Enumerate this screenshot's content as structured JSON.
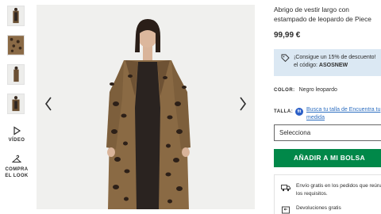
{
  "sidebar": {
    "video_label": "VÍDEO",
    "compra_label_1": "COMPRA",
    "compra_label_2": "EL LOOK"
  },
  "product": {
    "title_line1": "Abrigo de vestir largo con",
    "title_line2": "estampado de leopardo de Piece",
    "price": "99,99 €",
    "promo_line1": "¡Consigue un 15% de descuento!",
    "promo_line2_prefix": "el código: ",
    "promo_code": "ASOSNEW",
    "color_label": "COLOR:",
    "color_value": "Negro leopardo",
    "talla_label": "TALLA:",
    "fit_badge": "fit",
    "size_link": "Busca tu talla de Encuentra tu medida",
    "size_select_placeholder": "Selecciona",
    "add_to_bag": "AÑADIR A MI BOLSA",
    "shipping_text": "Envío gratis en los pedidos que reúnan los requisitos.",
    "returns_text": "Devoluciones gratis"
  },
  "colors": {
    "accent_green": "#018849",
    "promo_bg": "#dbe8f3",
    "link_blue": "#2d6ec0"
  }
}
